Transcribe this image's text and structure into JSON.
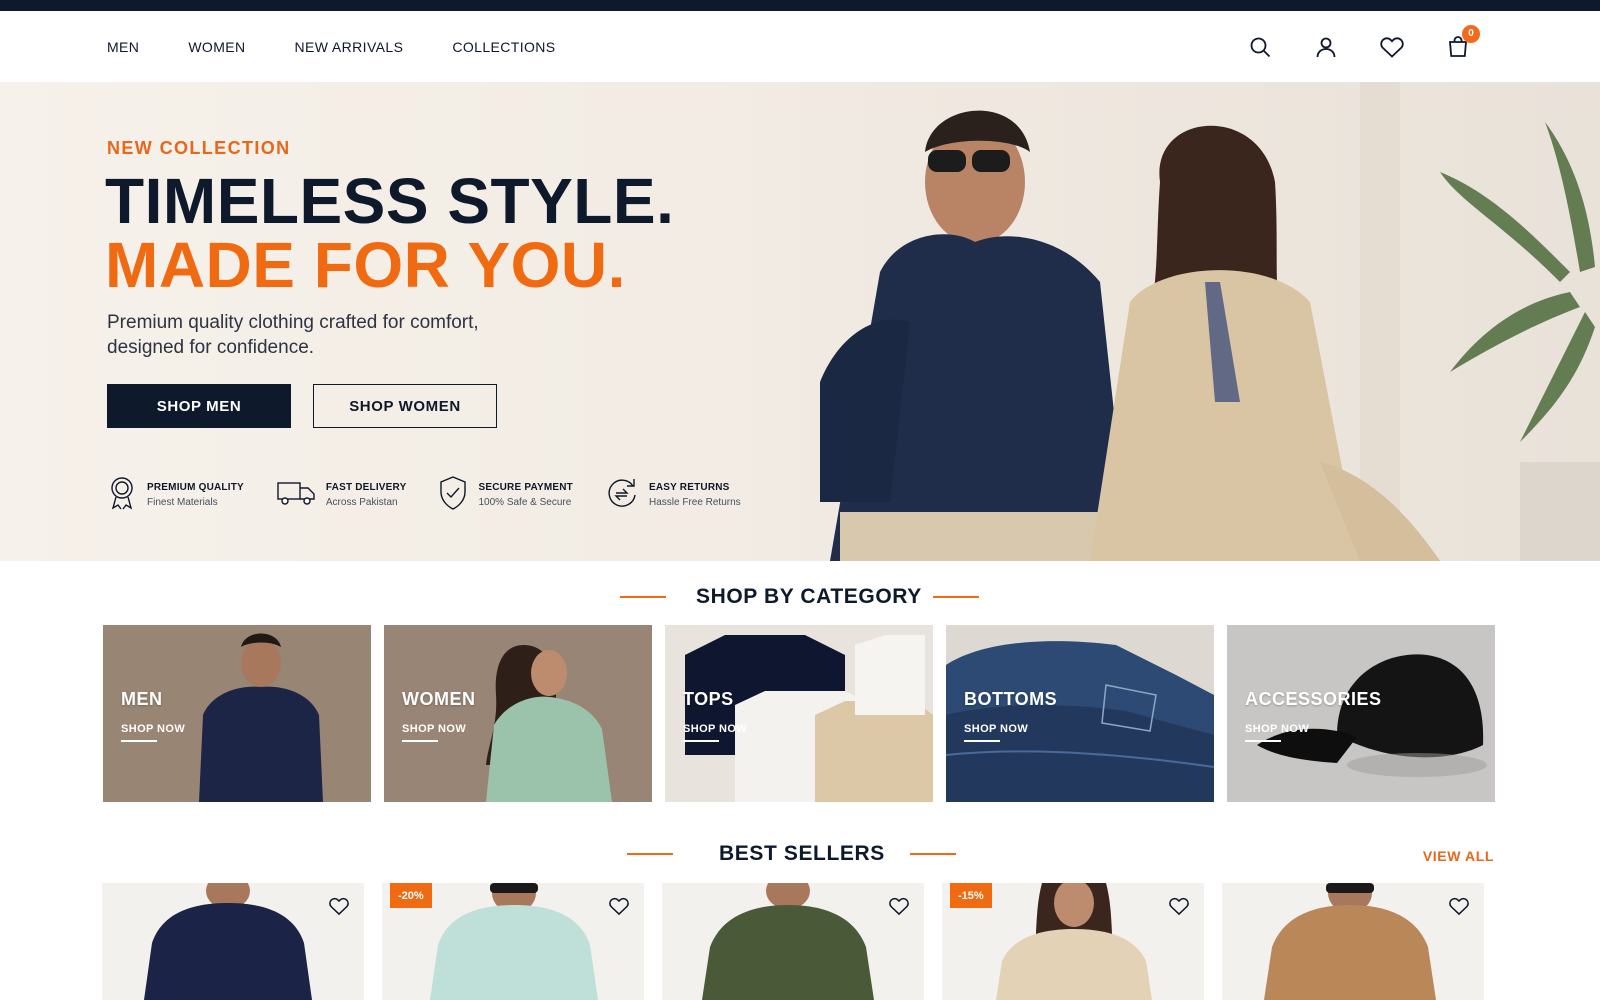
{
  "nav": {
    "items": [
      "MEN",
      "WOMEN",
      "NEW ARRIVALS",
      "COLLECTIONS"
    ]
  },
  "header": {
    "cart_count": "0",
    "icons": [
      "search-icon",
      "user-icon",
      "heart-icon",
      "cart-icon"
    ]
  },
  "hero": {
    "kicker": "NEW COLLECTION",
    "title_line1": "TIMELESS STYLE.",
    "title_line2": "MADE FOR YOU.",
    "subtitle": "Premium quality clothing crafted for comfort, designed for confidence.",
    "btn_primary": "SHOP MEN",
    "btn_secondary": "SHOP WOMEN",
    "features": [
      {
        "title": "PREMIUM QUALITY",
        "sub": "Finest Materials",
        "icon": "medal-icon"
      },
      {
        "title": "FAST DELIVERY",
        "sub": "Across Pakistan",
        "icon": "truck-icon"
      },
      {
        "title": "SECURE PAYMENT",
        "sub": "100% Safe & Secure",
        "icon": "shield-check-icon"
      },
      {
        "title": "EASY RETURNS",
        "sub": "Hassle Free Returns",
        "icon": "return-icon"
      }
    ]
  },
  "categories": {
    "title": "SHOP BY CATEGORY",
    "items": [
      {
        "label": "MEN",
        "cta": "SHOP NOW"
      },
      {
        "label": "WOMEN",
        "cta": "SHOP NOW"
      },
      {
        "label": "TOPS",
        "cta": "SHOP NOW"
      },
      {
        "label": "BOTTOMS",
        "cta": "SHOP NOW"
      },
      {
        "label": "ACCESSORIES",
        "cta": "SHOP NOW"
      }
    ]
  },
  "best_sellers": {
    "title": "BEST SELLERS",
    "view_all": "VIEW ALL",
    "products": [
      {
        "badge": ""
      },
      {
        "badge": "-20%"
      },
      {
        "badge": ""
      },
      {
        "badge": "-15%"
      },
      {
        "badge": ""
      }
    ]
  },
  "colors": {
    "navy": "#0e1a2b",
    "accent": "#f06a12"
  }
}
